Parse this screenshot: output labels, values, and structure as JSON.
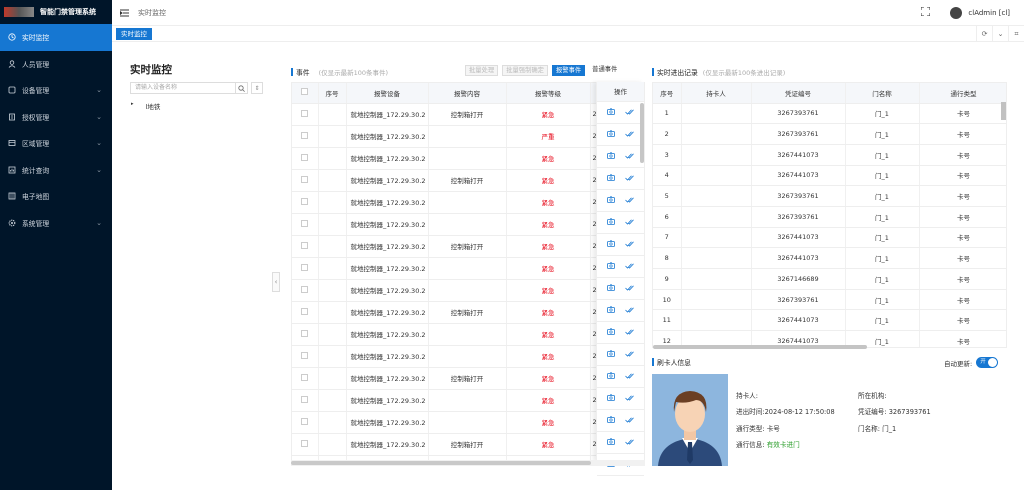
{
  "sidebar": {
    "app_title": "智能门禁管理系统",
    "items": [
      {
        "label": "实时监控",
        "icon": "monitor-icon",
        "active": true,
        "has_children": false
      },
      {
        "label": "人员管理",
        "icon": "person-icon",
        "active": false,
        "has_children": false
      },
      {
        "label": "设备管理",
        "icon": "device-icon",
        "active": false,
        "has_children": true
      },
      {
        "label": "授权管理",
        "icon": "auth-icon",
        "active": false,
        "has_children": true
      },
      {
        "label": "区域管理",
        "icon": "area-icon",
        "active": false,
        "has_children": true
      },
      {
        "label": "统计查询",
        "icon": "stats-icon",
        "active": false,
        "has_children": true
      },
      {
        "label": "电子地图",
        "icon": "map-icon",
        "active": false,
        "has_children": false
      },
      {
        "label": "系统管理",
        "icon": "gear-icon",
        "active": false,
        "has_children": true
      }
    ]
  },
  "header": {
    "breadcrumb": "实时监控",
    "user": "clAdmin [cl]"
  },
  "tabs": [
    {
      "label": "实时监控"
    }
  ],
  "left_panel": {
    "title": "实时监控",
    "search_placeholder": "请输入设备名称",
    "tree_root": "l地铁"
  },
  "events": {
    "title": "事件",
    "note": "(仅显示最新100条事件)",
    "buttons": {
      "batch_process": "批量处理",
      "batch_force_confirm": "批量强制确定",
      "alarm_events": "报警事件",
      "normal_events": "普通事件"
    },
    "columns": [
      "序号",
      "报警设备",
      "报警内容",
      "报警等级",
      "",
      "操作"
    ],
    "rows": [
      {
        "device": "就地控制器_172.29.30.2",
        "content": "控制箱打开",
        "level": "紧急",
        "extra": "2"
      },
      {
        "device": "就地控制器_172.29.30.2",
        "content": "",
        "level": "严重",
        "extra": "2"
      },
      {
        "device": "就地控制器_172.29.30.2",
        "content": "",
        "level": "紧急",
        "extra": "2"
      },
      {
        "device": "就地控制器_172.29.30.2",
        "content": "控制箱打开",
        "level": "紧急",
        "extra": "2"
      },
      {
        "device": "就地控制器_172.29.30.2",
        "content": "",
        "level": "紧急",
        "extra": "2"
      },
      {
        "device": "就地控制器_172.29.30.2",
        "content": "",
        "level": "紧急",
        "extra": "2"
      },
      {
        "device": "就地控制器_172.29.30.2",
        "content": "控制箱打开",
        "level": "紧急",
        "extra": "2"
      },
      {
        "device": "就地控制器_172.29.30.2",
        "content": "",
        "level": "紧急",
        "extra": "2"
      },
      {
        "device": "就地控制器_172.29.30.2",
        "content": "",
        "level": "紧急",
        "extra": "2"
      },
      {
        "device": "就地控制器_172.29.30.2",
        "content": "控制箱打开",
        "level": "紧急",
        "extra": "2"
      },
      {
        "device": "就地控制器_172.29.30.2",
        "content": "",
        "level": "紧急",
        "extra": "2"
      },
      {
        "device": "就地控制器_172.29.30.2",
        "content": "",
        "level": "紧急",
        "extra": "2"
      },
      {
        "device": "就地控制器_172.29.30.2",
        "content": "控制箱打开",
        "level": "紧急",
        "extra": "2"
      },
      {
        "device": "就地控制器_172.29.30.2",
        "content": "",
        "level": "紧急",
        "extra": "2"
      },
      {
        "device": "就地控制器_172.29.30.2",
        "content": "",
        "level": "紧急",
        "extra": "2"
      },
      {
        "device": "就地控制器_172.29.30.2",
        "content": "控制箱打开",
        "level": "紧急",
        "extra": "2"
      },
      {
        "device": "就地控制器_172.29.30.2",
        "content": "",
        "level": "紧急",
        "extra": "2"
      }
    ]
  },
  "access": {
    "title": "实时进出记录",
    "note": "(仅显示最新100条进出记录)",
    "columns": [
      "序号",
      "持卡人",
      "凭证编号",
      "门名称",
      "通行类型"
    ],
    "rows": [
      {
        "no": "1",
        "holder": "",
        "cred": "3267393761",
        "door": "门_1",
        "type": "卡号"
      },
      {
        "no": "2",
        "holder": "",
        "cred": "3267393761",
        "door": "门_1",
        "type": "卡号"
      },
      {
        "no": "3",
        "holder": "",
        "cred": "3267441073",
        "door": "门_1",
        "type": "卡号"
      },
      {
        "no": "4",
        "holder": "",
        "cred": "3267441073",
        "door": "门_1",
        "type": "卡号"
      },
      {
        "no": "5",
        "holder": "",
        "cred": "3267393761",
        "door": "门_1",
        "type": "卡号"
      },
      {
        "no": "6",
        "holder": "",
        "cred": "3267393761",
        "door": "门_1",
        "type": "卡号"
      },
      {
        "no": "7",
        "holder": "",
        "cred": "3267441073",
        "door": "门_1",
        "type": "卡号"
      },
      {
        "no": "8",
        "holder": "",
        "cred": "3267441073",
        "door": "门_1",
        "type": "卡号"
      },
      {
        "no": "9",
        "holder": "",
        "cred": "3267146689",
        "door": "门_1",
        "type": "卡号"
      },
      {
        "no": "10",
        "holder": "",
        "cred": "3267393761",
        "door": "门_1",
        "type": "卡号"
      },
      {
        "no": "11",
        "holder": "",
        "cred": "3267441073",
        "door": "门_1",
        "type": "卡号"
      },
      {
        "no": "12",
        "holder": "",
        "cred": "3267441073",
        "door": "门_1",
        "type": "卡号"
      }
    ]
  },
  "card_info": {
    "title": "刷卡人信息",
    "auto_update_label": "自动更新:",
    "switch_label": "开",
    "holder_label": "持卡人:",
    "holder_value": "",
    "org_label": "所在机构:",
    "org_value": "",
    "time_label": "进出时间:",
    "time_value": "2024-08-12 17:50:08",
    "cred_label": "凭证编号:",
    "cred_value": "3267393761",
    "type_label": "通行类型:",
    "type_value": "卡号",
    "door_label": "门名称:",
    "door_value": "门_1",
    "pass_label": "通行信息:",
    "pass_value": "有效卡进门"
  },
  "colors": {
    "primary": "#1677d2",
    "sidebar": "#001529",
    "danger": "#e60012",
    "success": "#2a9d2a"
  }
}
